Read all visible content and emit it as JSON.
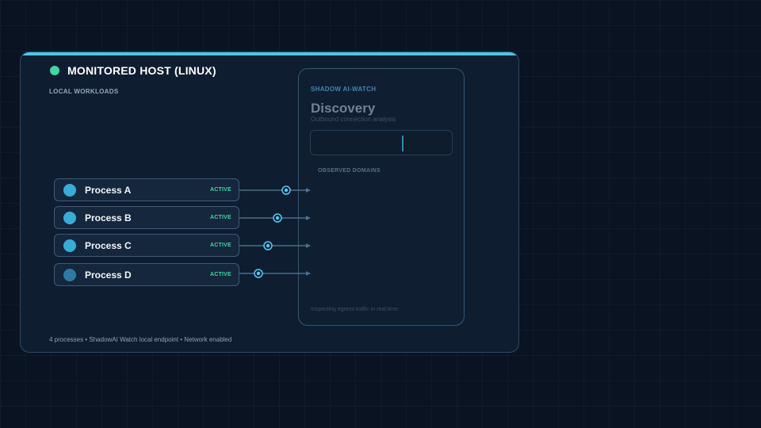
{
  "host": {
    "title": "MONITORED HOST (LINUX)",
    "section_label": "LOCAL WORKLOADS",
    "footer": "4 processes  •  ShadowAI Watch local endpoint  •  Network enabled",
    "accent_color": "#4ec3ee",
    "status_color": "#3fd6a6"
  },
  "processes": [
    {
      "name": "Process A",
      "status": "ACTIVE"
    },
    {
      "name": "Process B",
      "status": "ACTIVE"
    },
    {
      "name": "Process C",
      "status": "ACTIVE"
    },
    {
      "name": "Process D",
      "status": "ACTIVE"
    }
  ],
  "watch": {
    "kicker": "SHADOW AI-WATCH",
    "title": "Discovery",
    "subtitle": "Outbound connection analysis",
    "input_value": "",
    "observed_label": "OBSERVED DOMAINS",
    "footer": "Inspecting egress traffic in real time"
  },
  "icons": {
    "status": "status-dot-icon",
    "process": "process-dot-icon",
    "packet": "packet-ring-icon",
    "arrow": "arrow-right-icon"
  }
}
